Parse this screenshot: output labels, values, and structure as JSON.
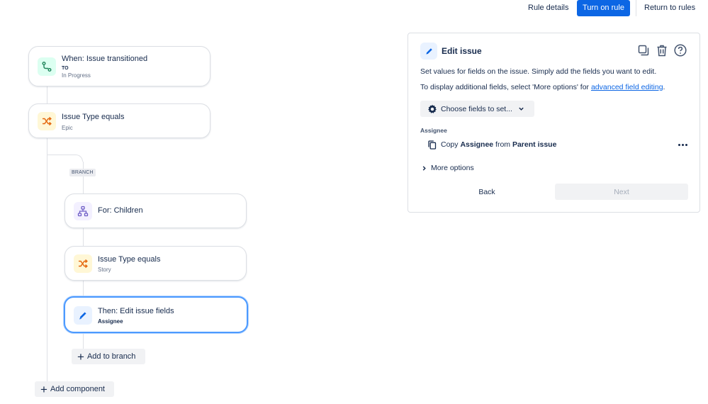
{
  "topbar": {
    "rule_details": "Rule details",
    "turn_on": "Turn on rule",
    "return": "Return to rules"
  },
  "flow": {
    "trigger": {
      "title": "When: Issue transitioned",
      "keyword": "TO",
      "subtitle": "In Progress",
      "icon": "transition-icon"
    },
    "condition1": {
      "title": "Issue Type equals",
      "subtitle": "Epic",
      "icon": "shuffle-icon"
    },
    "branch_label": "BRANCH",
    "branch": {
      "title": "For: Children",
      "icon": "hierarchy-icon"
    },
    "condition2": {
      "title": "Issue Type equals",
      "subtitle": "Story",
      "icon": "shuffle-icon"
    },
    "action": {
      "title": "Then: Edit issue fields",
      "subtitle": "Assignee",
      "icon": "pencil-icon"
    },
    "add_to_branch": "Add to branch",
    "add_component": "Add component"
  },
  "panel": {
    "title": "Edit issue",
    "description": "Set values for fields on the issue. Simply add the fields you want to edit.",
    "additional_prefix": "To display additional fields, select 'More options' for ",
    "additional_link": "advanced field editing",
    "additional_suffix": ".",
    "choose_fields": "Choose fields to set...",
    "field_label": "Assignee",
    "copy_word": "Copy",
    "copy_field": "Assignee",
    "from_word": "from",
    "copy_source": "Parent issue",
    "more_options": "More options",
    "back": "Back",
    "next": "Next"
  },
  "colors": {
    "primary": "#0c66e4",
    "selected_border": "#4c9aff",
    "connector": "#dfe1e6"
  }
}
